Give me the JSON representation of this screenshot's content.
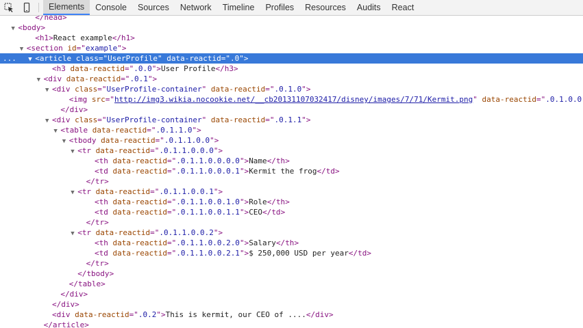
{
  "toolbar": {
    "icons": [
      "inspect-element-icon",
      "device-mode-icon"
    ],
    "tabs": [
      "Elements",
      "Console",
      "Sources",
      "Network",
      "Timeline",
      "Profiles",
      "Resources",
      "Audits",
      "React"
    ],
    "active_tab": "Elements",
    "accent_color": "#3e82f7"
  },
  "selection_gutter": "...",
  "tree": {
    "rows": [
      {
        "indent": 3,
        "toggle": "",
        "parts": [
          {
            "t": "tag",
            "v": "</"
          },
          {
            "t": "tag",
            "v": "head"
          },
          {
            "t": "tag",
            "v": ">"
          }
        ]
      },
      {
        "indent": 1,
        "toggle": "▼",
        "parts": [
          {
            "t": "tag",
            "v": "<"
          },
          {
            "t": "tag",
            "v": "body"
          },
          {
            "t": "tag",
            "v": ">"
          }
        ]
      },
      {
        "indent": 3,
        "toggle": "",
        "parts": [
          {
            "t": "tag",
            "v": "<"
          },
          {
            "t": "tag",
            "v": "h1"
          },
          {
            "t": "tag",
            "v": ">"
          },
          {
            "t": "txt",
            "v": "React example"
          },
          {
            "t": "tag",
            "v": "</"
          },
          {
            "t": "tag",
            "v": "h1"
          },
          {
            "t": "tag",
            "v": ">"
          }
        ]
      },
      {
        "indent": 2,
        "toggle": "▼",
        "parts": [
          {
            "t": "tag",
            "v": "<"
          },
          {
            "t": "tag",
            "v": "section"
          },
          {
            "t": "an",
            "v": " id"
          },
          {
            "t": "tag",
            "v": "=\""
          },
          {
            "t": "av",
            "v": "example"
          },
          {
            "t": "tag",
            "v": "\">"
          }
        ]
      },
      {
        "indent": 3,
        "toggle": "▼",
        "selected": true,
        "parts": [
          {
            "t": "tag",
            "v": "<"
          },
          {
            "t": "tag",
            "v": "article"
          },
          {
            "t": "an",
            "v": " class"
          },
          {
            "t": "tag",
            "v": "=\""
          },
          {
            "t": "av",
            "v": "UserProfile"
          },
          {
            "t": "tag",
            "v": "\""
          },
          {
            "t": "an",
            "v": " data-reactid"
          },
          {
            "t": "tag",
            "v": "=\""
          },
          {
            "t": "av",
            "v": ".0"
          },
          {
            "t": "tag",
            "v": "\">"
          }
        ]
      },
      {
        "indent": 5,
        "toggle": "",
        "parts": [
          {
            "t": "tag",
            "v": "<"
          },
          {
            "t": "tag",
            "v": "h3"
          },
          {
            "t": "an",
            "v": " data-reactid"
          },
          {
            "t": "tag",
            "v": "=\""
          },
          {
            "t": "av",
            "v": ".0.0"
          },
          {
            "t": "tag",
            "v": "\">"
          },
          {
            "t": "txt",
            "v": "User Profile"
          },
          {
            "t": "tag",
            "v": "</"
          },
          {
            "t": "tag",
            "v": "h3"
          },
          {
            "t": "tag",
            "v": ">"
          }
        ]
      },
      {
        "indent": 4,
        "toggle": "▼",
        "parts": [
          {
            "t": "tag",
            "v": "<"
          },
          {
            "t": "tag",
            "v": "div"
          },
          {
            "t": "an",
            "v": " data-reactid"
          },
          {
            "t": "tag",
            "v": "=\""
          },
          {
            "t": "av",
            "v": ".0.1"
          },
          {
            "t": "tag",
            "v": "\">"
          }
        ]
      },
      {
        "indent": 5,
        "toggle": "▼",
        "parts": [
          {
            "t": "tag",
            "v": "<"
          },
          {
            "t": "tag",
            "v": "div"
          },
          {
            "t": "an",
            "v": " class"
          },
          {
            "t": "tag",
            "v": "=\""
          },
          {
            "t": "av",
            "v": "UserProfile-container"
          },
          {
            "t": "tag",
            "v": "\""
          },
          {
            "t": "an",
            "v": " data-reactid"
          },
          {
            "t": "tag",
            "v": "=\""
          },
          {
            "t": "av",
            "v": ".0.1.0"
          },
          {
            "t": "tag",
            "v": "\">"
          }
        ]
      },
      {
        "indent": 7,
        "toggle": "",
        "parts": [
          {
            "t": "tag",
            "v": "<"
          },
          {
            "t": "tag",
            "v": "img"
          },
          {
            "t": "an",
            "v": " src"
          },
          {
            "t": "tag",
            "v": "=\""
          },
          {
            "t": "link",
            "v": "http://img3.wikia.nocookie.net/__cb20131107032417/disney/images/7/71/Kermit.png"
          },
          {
            "t": "tag",
            "v": "\""
          },
          {
            "t": "an",
            "v": " data-reactid"
          },
          {
            "t": "tag",
            "v": "=\""
          },
          {
            "t": "av",
            "v": ".0.1.0.0"
          },
          {
            "t": "tag",
            "v": "\">"
          }
        ]
      },
      {
        "indent": 6,
        "toggle": "",
        "parts": [
          {
            "t": "tag",
            "v": "</"
          },
          {
            "t": "tag",
            "v": "div"
          },
          {
            "t": "tag",
            "v": ">"
          }
        ]
      },
      {
        "indent": 5,
        "toggle": "▼",
        "parts": [
          {
            "t": "tag",
            "v": "<"
          },
          {
            "t": "tag",
            "v": "div"
          },
          {
            "t": "an",
            "v": " class"
          },
          {
            "t": "tag",
            "v": "=\""
          },
          {
            "t": "av",
            "v": "UserProfile-container"
          },
          {
            "t": "tag",
            "v": "\""
          },
          {
            "t": "an",
            "v": " data-reactid"
          },
          {
            "t": "tag",
            "v": "=\""
          },
          {
            "t": "av",
            "v": ".0.1.1"
          },
          {
            "t": "tag",
            "v": "\">"
          }
        ]
      },
      {
        "indent": 6,
        "toggle": "▼",
        "parts": [
          {
            "t": "tag",
            "v": "<"
          },
          {
            "t": "tag",
            "v": "table"
          },
          {
            "t": "an",
            "v": " data-reactid"
          },
          {
            "t": "tag",
            "v": "=\""
          },
          {
            "t": "av",
            "v": ".0.1.1.0"
          },
          {
            "t": "tag",
            "v": "\">"
          }
        ]
      },
      {
        "indent": 7,
        "toggle": "▼",
        "parts": [
          {
            "t": "tag",
            "v": "<"
          },
          {
            "t": "tag",
            "v": "tbody"
          },
          {
            "t": "an",
            "v": " data-reactid"
          },
          {
            "t": "tag",
            "v": "=\""
          },
          {
            "t": "av",
            "v": ".0.1.1.0.0"
          },
          {
            "t": "tag",
            "v": "\">"
          }
        ]
      },
      {
        "indent": 8,
        "toggle": "▼",
        "parts": [
          {
            "t": "tag",
            "v": "<"
          },
          {
            "t": "tag",
            "v": "tr"
          },
          {
            "t": "an",
            "v": " data-reactid"
          },
          {
            "t": "tag",
            "v": "=\""
          },
          {
            "t": "av",
            "v": ".0.1.1.0.0.0"
          },
          {
            "t": "tag",
            "v": "\">"
          }
        ]
      },
      {
        "indent": 10,
        "toggle": "",
        "parts": [
          {
            "t": "tag",
            "v": "<"
          },
          {
            "t": "tag",
            "v": "th"
          },
          {
            "t": "an",
            "v": " data-reactid"
          },
          {
            "t": "tag",
            "v": "=\""
          },
          {
            "t": "av",
            "v": ".0.1.1.0.0.0.0"
          },
          {
            "t": "tag",
            "v": "\">"
          },
          {
            "t": "txt",
            "v": "Name"
          },
          {
            "t": "tag",
            "v": "</"
          },
          {
            "t": "tag",
            "v": "th"
          },
          {
            "t": "tag",
            "v": ">"
          }
        ]
      },
      {
        "indent": 10,
        "toggle": "",
        "parts": [
          {
            "t": "tag",
            "v": "<"
          },
          {
            "t": "tag",
            "v": "td"
          },
          {
            "t": "an",
            "v": " data-reactid"
          },
          {
            "t": "tag",
            "v": "=\""
          },
          {
            "t": "av",
            "v": ".0.1.1.0.0.0.1"
          },
          {
            "t": "tag",
            "v": "\">"
          },
          {
            "t": "txt",
            "v": "Kermit the frog"
          },
          {
            "t": "tag",
            "v": "</"
          },
          {
            "t": "tag",
            "v": "td"
          },
          {
            "t": "tag",
            "v": ">"
          }
        ]
      },
      {
        "indent": 9,
        "toggle": "",
        "parts": [
          {
            "t": "tag",
            "v": "</"
          },
          {
            "t": "tag",
            "v": "tr"
          },
          {
            "t": "tag",
            "v": ">"
          }
        ]
      },
      {
        "indent": 8,
        "toggle": "▼",
        "parts": [
          {
            "t": "tag",
            "v": "<"
          },
          {
            "t": "tag",
            "v": "tr"
          },
          {
            "t": "an",
            "v": " data-reactid"
          },
          {
            "t": "tag",
            "v": "=\""
          },
          {
            "t": "av",
            "v": ".0.1.1.0.0.1"
          },
          {
            "t": "tag",
            "v": "\">"
          }
        ]
      },
      {
        "indent": 10,
        "toggle": "",
        "parts": [
          {
            "t": "tag",
            "v": "<"
          },
          {
            "t": "tag",
            "v": "th"
          },
          {
            "t": "an",
            "v": " data-reactid"
          },
          {
            "t": "tag",
            "v": "=\""
          },
          {
            "t": "av",
            "v": ".0.1.1.0.0.1.0"
          },
          {
            "t": "tag",
            "v": "\">"
          },
          {
            "t": "txt",
            "v": "Role"
          },
          {
            "t": "tag",
            "v": "</"
          },
          {
            "t": "tag",
            "v": "th"
          },
          {
            "t": "tag",
            "v": ">"
          }
        ]
      },
      {
        "indent": 10,
        "toggle": "",
        "parts": [
          {
            "t": "tag",
            "v": "<"
          },
          {
            "t": "tag",
            "v": "td"
          },
          {
            "t": "an",
            "v": " data-reactid"
          },
          {
            "t": "tag",
            "v": "=\""
          },
          {
            "t": "av",
            "v": ".0.1.1.0.0.1.1"
          },
          {
            "t": "tag",
            "v": "\">"
          },
          {
            "t": "txt",
            "v": "CEO"
          },
          {
            "t": "tag",
            "v": "</"
          },
          {
            "t": "tag",
            "v": "td"
          },
          {
            "t": "tag",
            "v": ">"
          }
        ]
      },
      {
        "indent": 9,
        "toggle": "",
        "parts": [
          {
            "t": "tag",
            "v": "</"
          },
          {
            "t": "tag",
            "v": "tr"
          },
          {
            "t": "tag",
            "v": ">"
          }
        ]
      },
      {
        "indent": 8,
        "toggle": "▼",
        "parts": [
          {
            "t": "tag",
            "v": "<"
          },
          {
            "t": "tag",
            "v": "tr"
          },
          {
            "t": "an",
            "v": " data-reactid"
          },
          {
            "t": "tag",
            "v": "=\""
          },
          {
            "t": "av",
            "v": ".0.1.1.0.0.2"
          },
          {
            "t": "tag",
            "v": "\">"
          }
        ]
      },
      {
        "indent": 10,
        "toggle": "",
        "parts": [
          {
            "t": "tag",
            "v": "<"
          },
          {
            "t": "tag",
            "v": "th"
          },
          {
            "t": "an",
            "v": " data-reactid"
          },
          {
            "t": "tag",
            "v": "=\""
          },
          {
            "t": "av",
            "v": ".0.1.1.0.0.2.0"
          },
          {
            "t": "tag",
            "v": "\">"
          },
          {
            "t": "txt",
            "v": "Salary"
          },
          {
            "t": "tag",
            "v": "</"
          },
          {
            "t": "tag",
            "v": "th"
          },
          {
            "t": "tag",
            "v": ">"
          }
        ]
      },
      {
        "indent": 10,
        "toggle": "",
        "parts": [
          {
            "t": "tag",
            "v": "<"
          },
          {
            "t": "tag",
            "v": "td"
          },
          {
            "t": "an",
            "v": " data-reactid"
          },
          {
            "t": "tag",
            "v": "=\""
          },
          {
            "t": "av",
            "v": ".0.1.1.0.0.2.1"
          },
          {
            "t": "tag",
            "v": "\">"
          },
          {
            "t": "txt",
            "v": "$ 250,000 USD per year"
          },
          {
            "t": "tag",
            "v": "</"
          },
          {
            "t": "tag",
            "v": "td"
          },
          {
            "t": "tag",
            "v": ">"
          }
        ]
      },
      {
        "indent": 9,
        "toggle": "",
        "parts": [
          {
            "t": "tag",
            "v": "</"
          },
          {
            "t": "tag",
            "v": "tr"
          },
          {
            "t": "tag",
            "v": ">"
          }
        ]
      },
      {
        "indent": 8,
        "toggle": "",
        "parts": [
          {
            "t": "tag",
            "v": "</"
          },
          {
            "t": "tag",
            "v": "tbody"
          },
          {
            "t": "tag",
            "v": ">"
          }
        ]
      },
      {
        "indent": 7,
        "toggle": "",
        "parts": [
          {
            "t": "tag",
            "v": "</"
          },
          {
            "t": "tag",
            "v": "table"
          },
          {
            "t": "tag",
            "v": ">"
          }
        ]
      },
      {
        "indent": 6,
        "toggle": "",
        "parts": [
          {
            "t": "tag",
            "v": "</"
          },
          {
            "t": "tag",
            "v": "div"
          },
          {
            "t": "tag",
            "v": ">"
          }
        ]
      },
      {
        "indent": 5,
        "toggle": "",
        "parts": [
          {
            "t": "tag",
            "v": "</"
          },
          {
            "t": "tag",
            "v": "div"
          },
          {
            "t": "tag",
            "v": ">"
          }
        ]
      },
      {
        "indent": 5,
        "toggle": "",
        "parts": [
          {
            "t": "tag",
            "v": "<"
          },
          {
            "t": "tag",
            "v": "div"
          },
          {
            "t": "an",
            "v": " data-reactid"
          },
          {
            "t": "tag",
            "v": "=\""
          },
          {
            "t": "av",
            "v": ".0.2"
          },
          {
            "t": "tag",
            "v": "\">"
          },
          {
            "t": "txt",
            "v": "This is kermit, our CEO of ...."
          },
          {
            "t": "tag",
            "v": "</"
          },
          {
            "t": "tag",
            "v": "div"
          },
          {
            "t": "tag",
            "v": ">"
          }
        ]
      },
      {
        "indent": 4,
        "toggle": "",
        "parts": [
          {
            "t": "tag",
            "v": "</"
          },
          {
            "t": "tag",
            "v": "article"
          },
          {
            "t": "tag",
            "v": ">"
          }
        ]
      }
    ]
  }
}
